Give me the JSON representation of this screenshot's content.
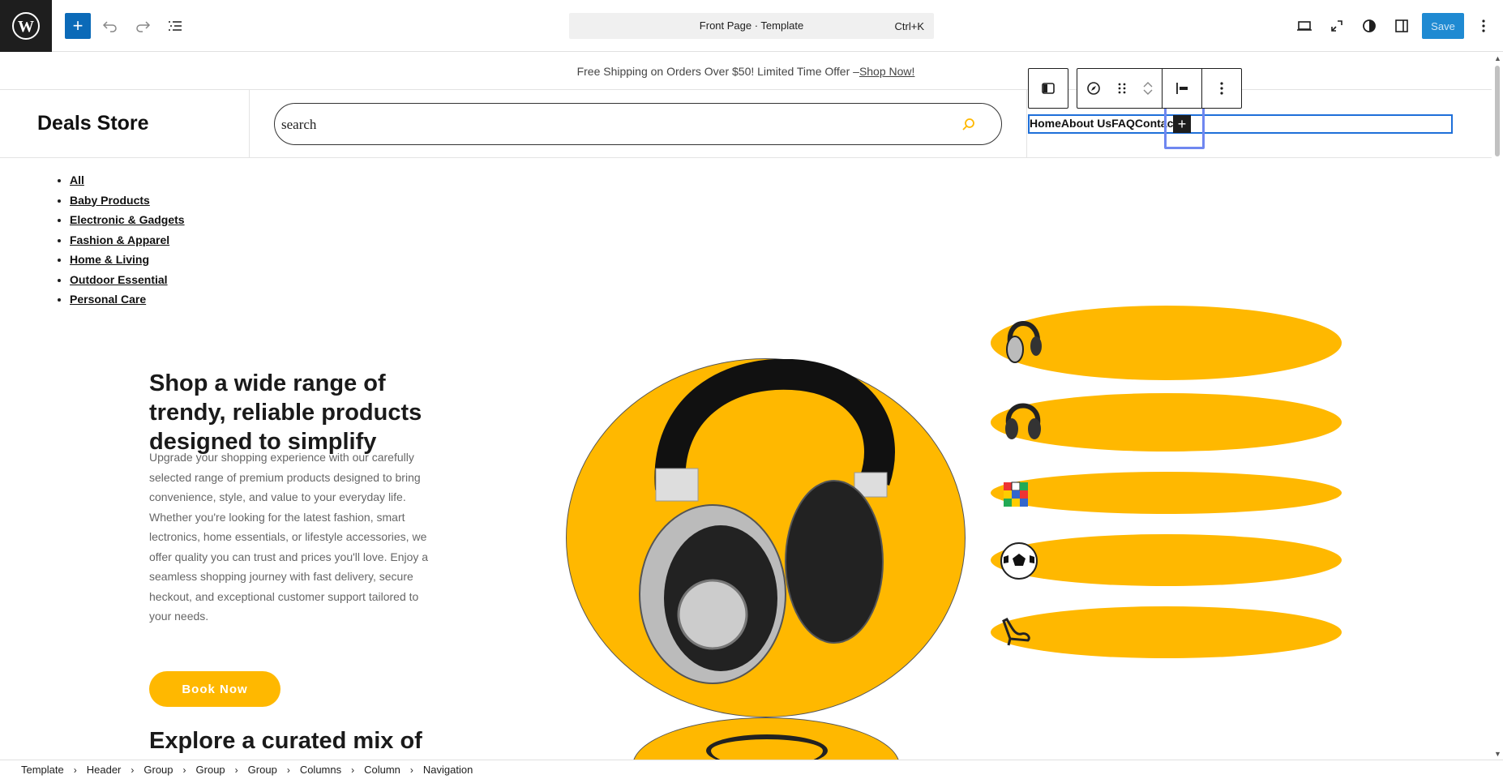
{
  "editor": {
    "command_title": "Front Page · Template",
    "command_shortcut": "Ctrl+K",
    "save_label": "Save",
    "icons": [
      "wordpress-icon",
      "plus-icon",
      "undo-icon",
      "redo-icon",
      "list-view-icon",
      "desktop-icon",
      "fullscreen-icon",
      "contrast-icon",
      "sidebar-icon",
      "more-vertical-icon"
    ]
  },
  "promo": {
    "text": "Free Shipping on Orders Over $50! Limited Time Offer –",
    "link": "Shop Now!"
  },
  "header": {
    "site_title": "Deals Store",
    "search_placeholder": "search",
    "nav_items": [
      "Home",
      "About Us",
      "FAQ",
      "Contact"
    ]
  },
  "categories": [
    "All",
    "Baby Products",
    "Electronic & Gadgets",
    "Fashion & Apparel",
    "Home & Living",
    "Outdoor Essential",
    "Personal Care"
  ],
  "hero": {
    "title": "Shop a wide range of trendy, reliable products designed to simplify",
    "text": "Upgrade your shopping experience with our carefully selected range of premium products designed to bring convenience, style, and value to your everyday life. Whether you're looking for the latest fashion, smart lectronics, home essentials, or lifestyle accessories, we offer quality you can trust and prices you'll love. Enjoy a seamless shopping journey with fast delivery, secure heckout, and exceptional customer support tailored to your needs.",
    "button_label": "Book Now",
    "next_title": "Explore a curated mix of"
  },
  "colors": {
    "accent": "#ffb800",
    "selection": "#1e6fd9",
    "admin_dark": "#1e1e1e"
  },
  "breadcrumb": [
    "Template",
    "Header",
    "Group",
    "Group",
    "Group",
    "Columns",
    "Column",
    "Navigation"
  ]
}
